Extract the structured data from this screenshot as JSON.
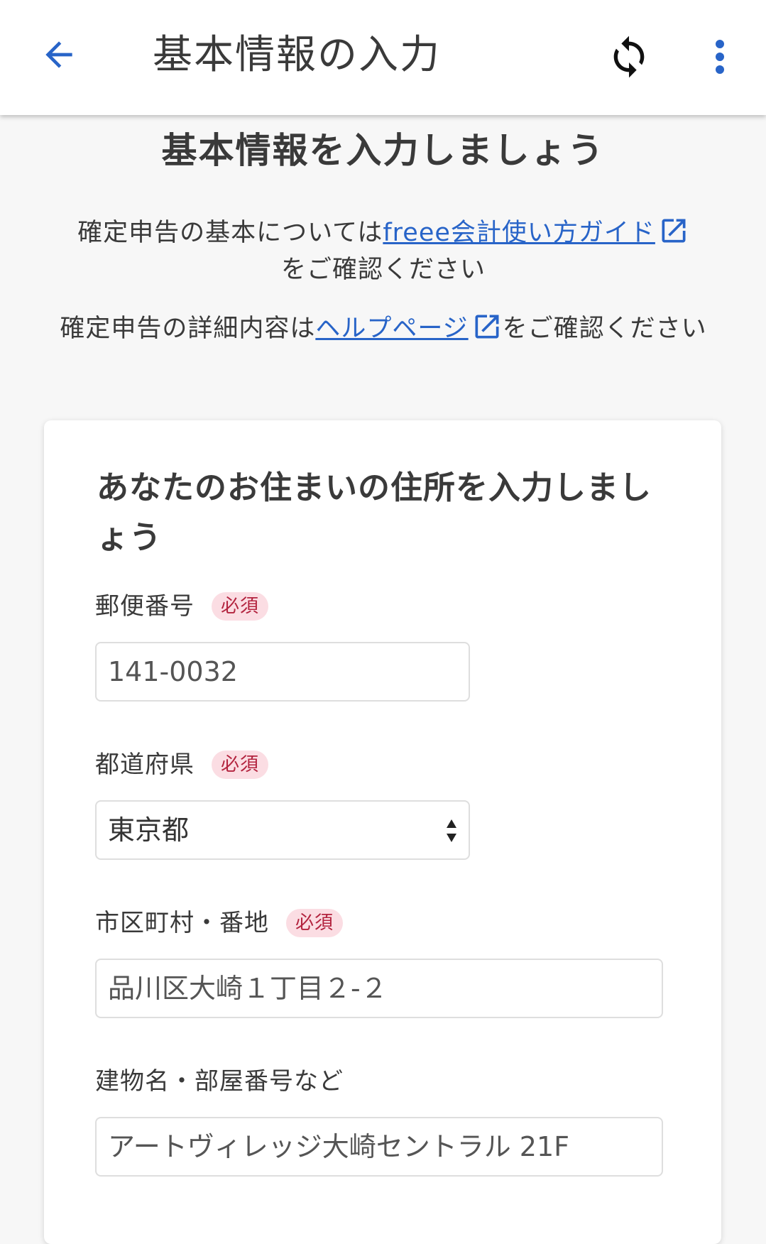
{
  "appbar": {
    "title": "基本情報の入力",
    "accent_color": "#2864c8",
    "back_icon": "arrow-left-icon",
    "sync_icon": "sync-icon",
    "more_icon": "more-vert-icon"
  },
  "page": {
    "headline": "基本情報を入力しましょう",
    "intro1_prefix": "確定申告の基本については",
    "intro1_link": "freee会計使い方ガイド",
    "intro1_suffix": "をご確認ください",
    "intro2_prefix": "確定申告の詳細内容は",
    "intro2_link": "ヘルプページ",
    "intro2_suffix": "をご確認ください",
    "external_link_icon": "open-in-new-icon"
  },
  "form": {
    "title": "あなたのお住まいの住所を入力しましょう",
    "required_label": "必須",
    "postal": {
      "label": "郵便番号",
      "value": "141-0032"
    },
    "prefecture": {
      "label": "都道府県",
      "value": "東京都"
    },
    "city": {
      "label": "市区町村・番地",
      "value": "品川区大崎１丁目２-２"
    },
    "building": {
      "label": "建物名・部屋番号など",
      "value": "アートヴィレッジ大崎セントラル 21F"
    }
  }
}
